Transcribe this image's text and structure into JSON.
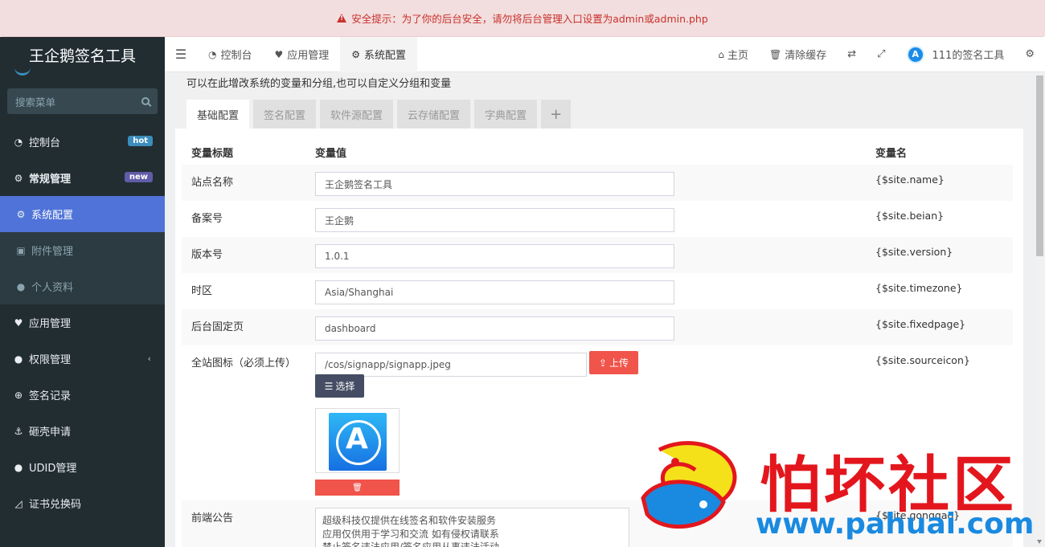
{
  "alert": {
    "text": "安全提示：为了你的后台安全，请勿将后台管理入口设置为admin或admin.php"
  },
  "sidebar": {
    "logo": "王企鹅签名工具",
    "search_placeholder": "搜索菜单",
    "items": [
      {
        "icon": "dashboard-icon",
        "label": "控制台",
        "badge": "hot"
      },
      {
        "icon": "cogs-icon",
        "label": "常规管理",
        "badge": "new"
      },
      {
        "icon": "gear-icon",
        "label": "系统配置"
      },
      {
        "icon": "image-icon",
        "label": "附件管理"
      },
      {
        "icon": "user-icon",
        "label": "个人资料"
      },
      {
        "icon": "heart-icon",
        "label": "应用管理"
      },
      {
        "icon": "users-icon",
        "label": "权限管理"
      },
      {
        "icon": "download-icon",
        "label": "签名记录"
      },
      {
        "icon": "anchor-icon",
        "label": "砸壳申请"
      },
      {
        "icon": "apple-icon",
        "label": "UDID管理"
      },
      {
        "icon": "cert-icon",
        "label": "证书兑换码"
      }
    ]
  },
  "topbar": {
    "tabs": [
      {
        "icon": "dashboard-icon",
        "label": "控制台"
      },
      {
        "icon": "heart-icon",
        "label": "应用管理"
      },
      {
        "icon": "gear-icon",
        "label": "系统配置"
      }
    ],
    "home": "主页",
    "clear_cache": "清除缓存",
    "user": "111的签名工具"
  },
  "main": {
    "description": "可以在此增改系统的变量和分组,也可以自定义分组和变量",
    "tabs": [
      "基础配置",
      "签名配置",
      "软件源配置",
      "云存储配置",
      "字典配置",
      "+"
    ],
    "headers": {
      "title": "变量标题",
      "value": "变量值",
      "name": "变量名"
    },
    "rows": [
      {
        "label": "站点名称",
        "value": "王企鹅签名工具",
        "var": "{$site.name}"
      },
      {
        "label": "备案号",
        "value": "王企鹅",
        "var": "{$site.beian}"
      },
      {
        "label": "版本号",
        "value": "1.0.1",
        "var": "{$site.version}"
      },
      {
        "label": "时区",
        "value": "Asia/Shanghai",
        "var": "{$site.timezone}"
      },
      {
        "label": "后台固定页",
        "value": "dashboard",
        "var": "{$site.fixedpage}"
      }
    ],
    "icon_row": {
      "label": "全站图标（必须上传）",
      "value": "/cos/signapp/signapp.jpeg",
      "var": "{$site.sourceicon}",
      "upload": "上传",
      "select": "选择",
      "delete": "🗑"
    },
    "notice_row": {
      "label": "前端公告",
      "lines": [
        "超级科技仅提供在线签名和软件安装服务",
        "应用仅供用于学习和交流  如有侵权请联系",
        "禁止签名违法应用/签名应用从事违法活动"
      ],
      "var": "{$site.gonggao}"
    }
  },
  "watermark": {
    "text": "怕坏社区",
    "url": "www.pahuai.com"
  }
}
